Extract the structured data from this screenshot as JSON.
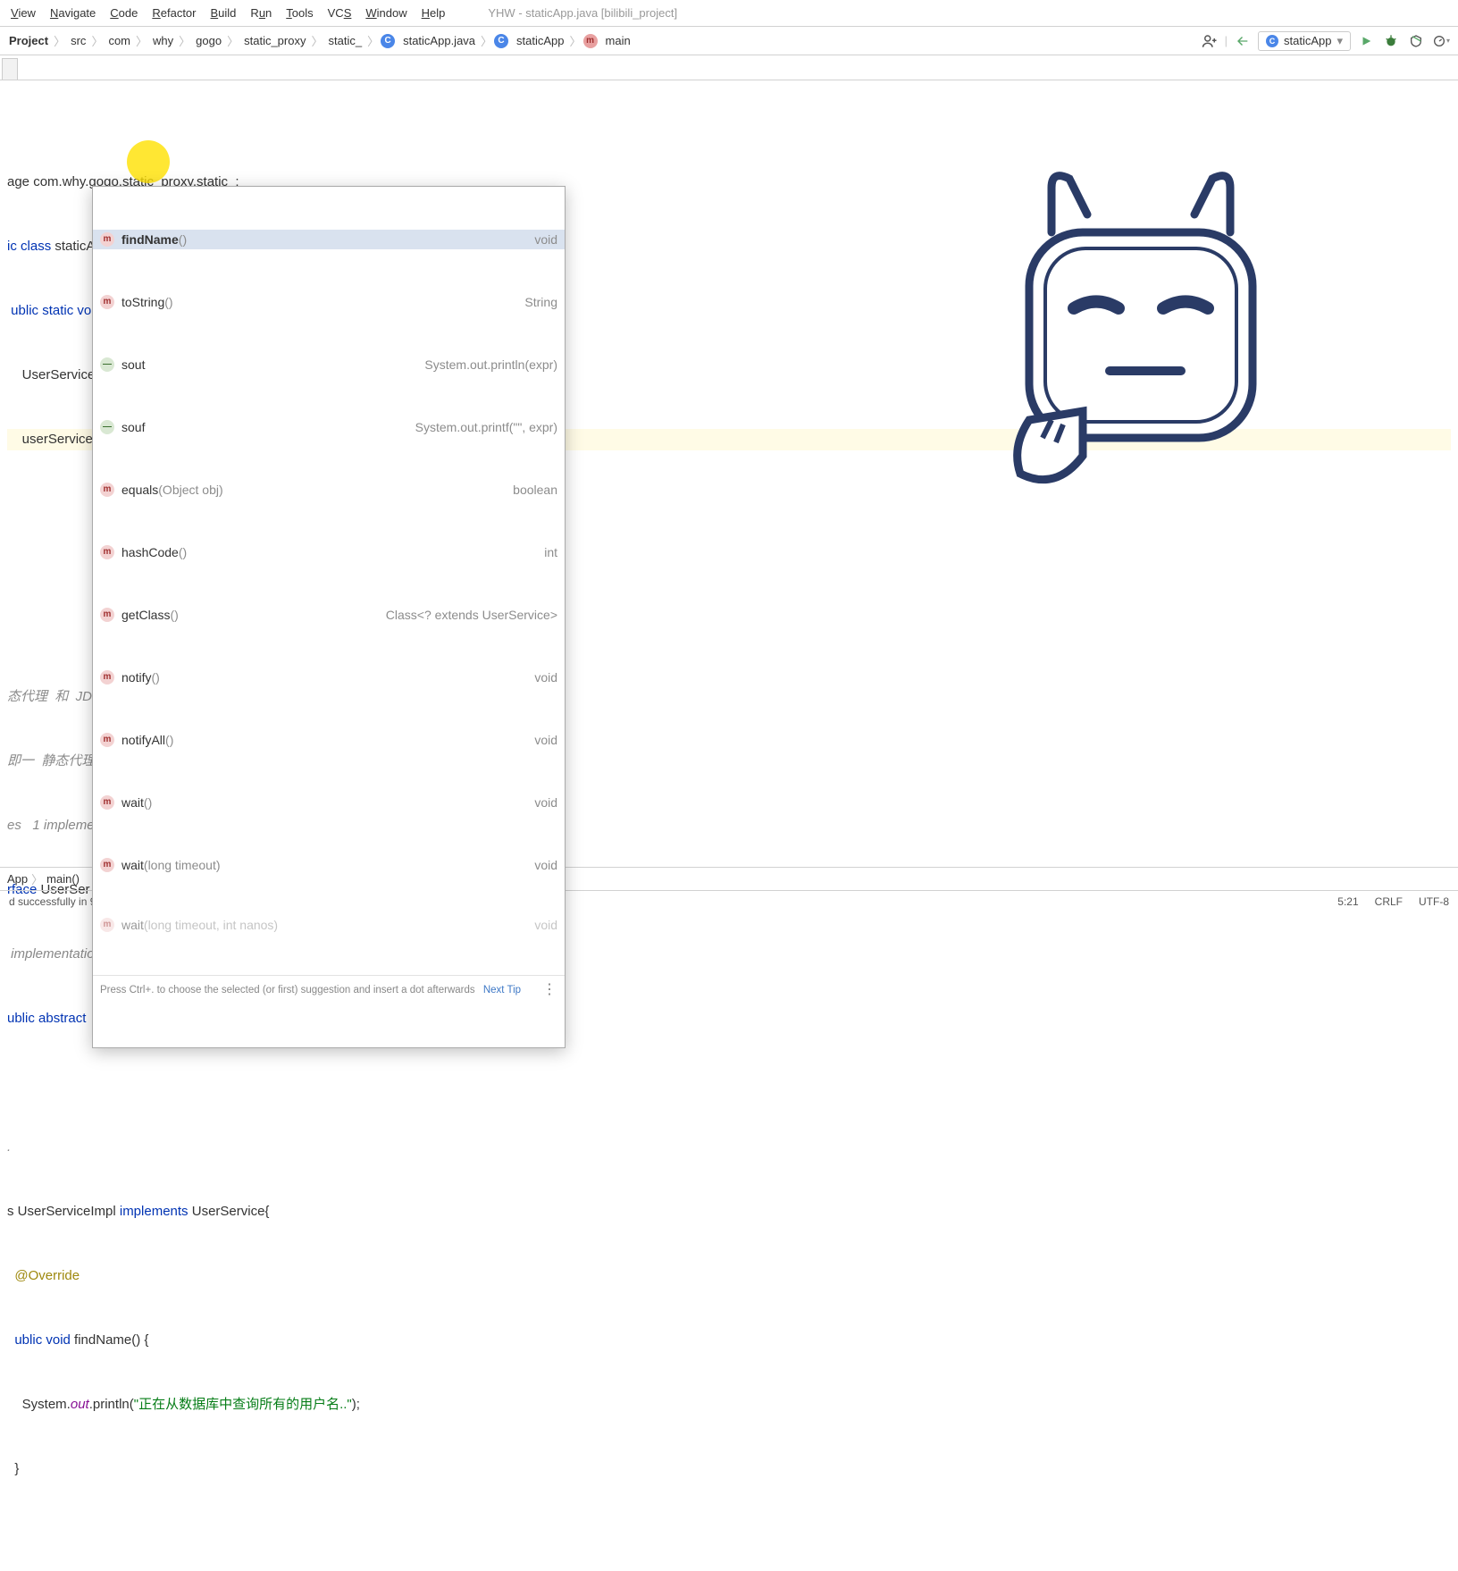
{
  "window_title": "YHW - staticApp.java [bilibili_project]",
  "menu": [
    "View",
    "Navigate",
    "Code",
    "Refactor",
    "Build",
    "Run",
    "Tools",
    "VCS",
    "Window",
    "Help"
  ],
  "breadcrumb": [
    "Project",
    "src",
    "com",
    "why",
    "gogo",
    "static_proxy",
    "static_"
  ],
  "breadcrumb_file": "staticApp.java",
  "breadcrumb_class": "staticApp",
  "breadcrumb_method": "main",
  "run_config": "staticApp",
  "code": {
    "l1_pkg": "age com.why.gogo.static_proxy.static_;",
    "l2": "ic class staticApp {",
    "l3": "ublic static void main(String[] args) {",
    "l4": "    UserService userService = new UserServiceImpl();",
    "l5": "    userService.",
    "frag1": "态代理  和  JDK动",
    "frag2": "即一  静态代理",
    "frag3": "es   1 implementation",
    "frag4": "rface UserSer",
    "frag5": " implementation",
    "frag6": "ublic abstract",
    "frag_dot": ".",
    "class2": "s UserServiceImpl implements UserService{",
    "override": "@Override",
    "fn": "ublic void findName() {",
    "println": "    System.out.println(\"正在从数据库中查询所有的用户名..\");",
    "close": "}"
  },
  "autocomplete": {
    "items": [
      {
        "icon": "m",
        "name": "findName",
        "params": "()",
        "right": "void",
        "bold": true
      },
      {
        "icon": "m",
        "name": "toString",
        "params": "()",
        "right": "String"
      },
      {
        "icon": "t",
        "name": "sout",
        "params": "",
        "right": "System.out.println(expr)"
      },
      {
        "icon": "t",
        "name": "souf",
        "params": "",
        "right": "System.out.printf(\"\", expr)"
      },
      {
        "icon": "m",
        "name": "equals",
        "params": "(Object obj)",
        "right": "boolean"
      },
      {
        "icon": "m",
        "name": "hashCode",
        "params": "()",
        "right": "int"
      },
      {
        "icon": "m",
        "name": "getClass",
        "params": "()",
        "right": "Class<? extends UserService>"
      },
      {
        "icon": "m",
        "name": "notify",
        "params": "()",
        "right": "void"
      },
      {
        "icon": "m",
        "name": "notifyAll",
        "params": "()",
        "right": "void"
      },
      {
        "icon": "m",
        "name": "wait",
        "params": "()",
        "right": "void"
      },
      {
        "icon": "m",
        "name": "wait",
        "params": "(long timeout)",
        "right": "void"
      },
      {
        "icon": "m",
        "name": "wait",
        "params": "(long timeout, int nanos)",
        "right": "void"
      }
    ],
    "hint": "Press Ctrl+. to choose the selected (or first) suggestion and insert a dot afterwards",
    "hint_link": "Next Tip"
  },
  "bottom_breadcrumb": {
    "a": "App",
    "b": "main()"
  },
  "status": {
    "build": "d successfully in 972 ms (4 minutes ago)",
    "pos": "5:21",
    "sep": "CRLF",
    "enc": "UTF-8"
  }
}
